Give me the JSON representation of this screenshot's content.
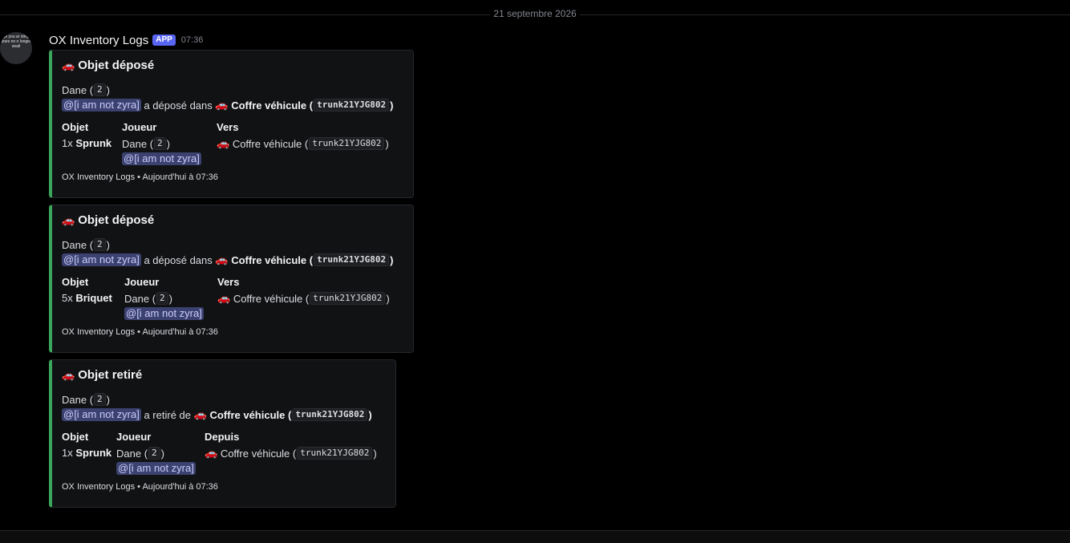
{
  "date_divider": "21 septembre 2026",
  "avatar_text": "ge you ar sting does no o longer avail",
  "message": {
    "author": "OX Inventory Logs",
    "badge": "APP",
    "time": "07:36"
  },
  "car_icon": "car-icon",
  "embeds": [
    {
      "title": "Objet déposé",
      "player_line": "Dane",
      "player_id": "2",
      "mention": "@[i am not zyra]",
      "action_text": "a déposé dans",
      "target_label": "Coffre véhicule",
      "target_id": "trunk21YJG802",
      "field1_name": "Objet",
      "field1_qty": "1x",
      "field1_item": "Sprunk",
      "field2_name": "Joueur",
      "field2_player": "Dane",
      "field2_id": "2",
      "field2_mention": "@[i am not zyra]",
      "field3_name": "Vers",
      "field3_label": "Coffre véhicule",
      "field3_id": "trunk21YJG802",
      "footer": "OX Inventory Logs • Aujourd'hui à 07:36"
    },
    {
      "title": "Objet déposé",
      "player_line": "Dane",
      "player_id": "2",
      "mention": "@[i am not zyra]",
      "action_text": "a déposé dans",
      "target_label": "Coffre véhicule",
      "target_id": "trunk21YJG802",
      "field1_name": "Objet",
      "field1_qty": "5x",
      "field1_item": "Briquet",
      "field2_name": "Joueur",
      "field2_player": "Dane",
      "field2_id": "2",
      "field2_mention": "@[i am not zyra]",
      "field3_name": "Vers",
      "field3_label": "Coffre véhicule",
      "field3_id": "trunk21YJG802",
      "footer": "OX Inventory Logs • Aujourd'hui à 07:36"
    },
    {
      "title": "Objet retiré",
      "player_line": "Dane",
      "player_id": "2",
      "mention": "@[i am not zyra]",
      "action_text": "a retiré de",
      "target_label": "Coffre véhicule",
      "target_id": "trunk21YJG802",
      "field1_name": "Objet",
      "field1_qty": "1x",
      "field1_item": "Sprunk",
      "field2_name": "Joueur",
      "field2_player": "Dane",
      "field2_id": "2",
      "field2_mention": "@[i am not zyra]",
      "field3_name": "Depuis",
      "field3_label": "Coffre véhicule",
      "field3_id": "trunk21YJG802",
      "footer": "OX Inventory Logs • Aujourd'hui à 07:36"
    }
  ],
  "colors": {
    "embed_border": "#3ba55c",
    "app_badge": "#5865f2",
    "mention_bg": "#3c4270"
  }
}
